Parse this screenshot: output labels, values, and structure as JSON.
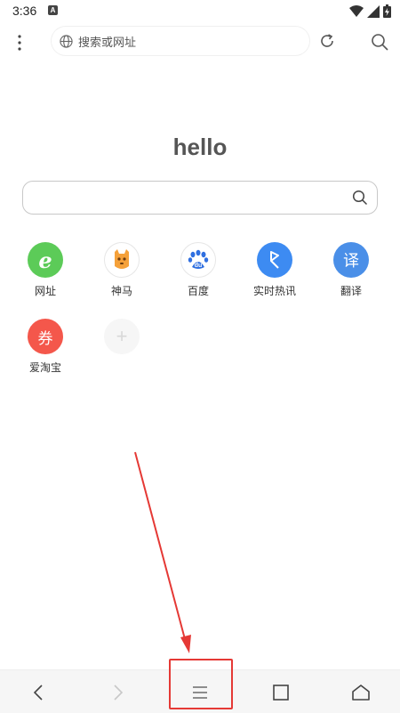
{
  "status_bar": {
    "time": "3:36",
    "app_badge": "A"
  },
  "browser_bar": {
    "url_placeholder": "搜索或网址"
  },
  "main": {
    "title": "hello"
  },
  "shortcuts": [
    {
      "label": "网址",
      "color": "#5ccb58",
      "glyph": "e"
    },
    {
      "label": "神马",
      "color": "#ffffff",
      "glyph": ""
    },
    {
      "label": "百度",
      "color": "#ffffff",
      "glyph": "du"
    },
    {
      "label": "实时热讯",
      "color": "#3d8bf2",
      "glyph": ""
    },
    {
      "label": "翻译",
      "color": "#4a8fe8",
      "glyph": "译"
    },
    {
      "label": "爱淘宝",
      "color": "#f4574b",
      "glyph": "券"
    },
    {
      "label": "",
      "color": "#f6f6f6",
      "glyph": "+"
    }
  ],
  "colors": {
    "highlight": "#e53935"
  }
}
